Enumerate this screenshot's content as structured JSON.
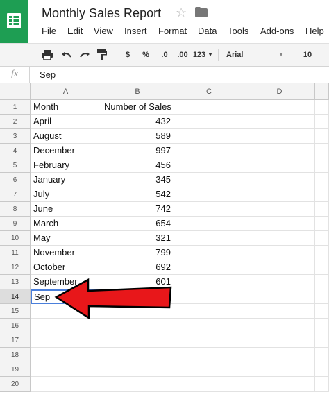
{
  "app": {
    "title": "Monthly Sales Report",
    "icons": [
      "sheets-logo-icon",
      "star-icon",
      "folder-icon"
    ],
    "brand_color": "#1e9e53"
  },
  "menu": [
    "File",
    "Edit",
    "View",
    "Insert",
    "Format",
    "Data",
    "Tools",
    "Add-ons",
    "Help"
  ],
  "toolbar": {
    "icons": [
      "print-icon",
      "undo-icon",
      "redo-icon",
      "paint-format-icon"
    ],
    "currency": "$",
    "percent": "%",
    "dec_less": ".0",
    "dec_more": ".00",
    "more_formats": "123",
    "font": "Arial",
    "font_size": "10"
  },
  "formula_bar": {
    "fx": "fx",
    "value": "Sep"
  },
  "sheet": {
    "columns": [
      "A",
      "B",
      "C",
      "D"
    ],
    "rows": [
      {
        "num": "1",
        "a": "Month",
        "b": "Number of Sales"
      },
      {
        "num": "2",
        "a": "April",
        "b": "432"
      },
      {
        "num": "3",
        "a": "August",
        "b": "589"
      },
      {
        "num": "4",
        "a": "December",
        "b": "997"
      },
      {
        "num": "5",
        "a": "February",
        "b": "456"
      },
      {
        "num": "6",
        "a": "January",
        "b": "345"
      },
      {
        "num": "7",
        "a": "July",
        "b": "542"
      },
      {
        "num": "8",
        "a": "June",
        "b": "742"
      },
      {
        "num": "9",
        "a": "March",
        "b": "654"
      },
      {
        "num": "10",
        "a": "May",
        "b": "321"
      },
      {
        "num": "11",
        "a": "November",
        "b": "799"
      },
      {
        "num": "12",
        "a": "October",
        "b": "692"
      },
      {
        "num": "13",
        "a": "September",
        "b": "601"
      },
      {
        "num": "14",
        "a": "Sep",
        "b": ""
      },
      {
        "num": "15",
        "a": "",
        "b": ""
      },
      {
        "num": "16",
        "a": "",
        "b": ""
      },
      {
        "num": "17",
        "a": "",
        "b": ""
      },
      {
        "num": "18",
        "a": "",
        "b": ""
      },
      {
        "num": "19",
        "a": "",
        "b": ""
      },
      {
        "num": "20",
        "a": "",
        "b": ""
      }
    ],
    "active_cell": "A14",
    "selection_color": "#4a7fdb"
  },
  "annotation": {
    "icon": "red-arrow-icon",
    "color": "#e8171a"
  }
}
